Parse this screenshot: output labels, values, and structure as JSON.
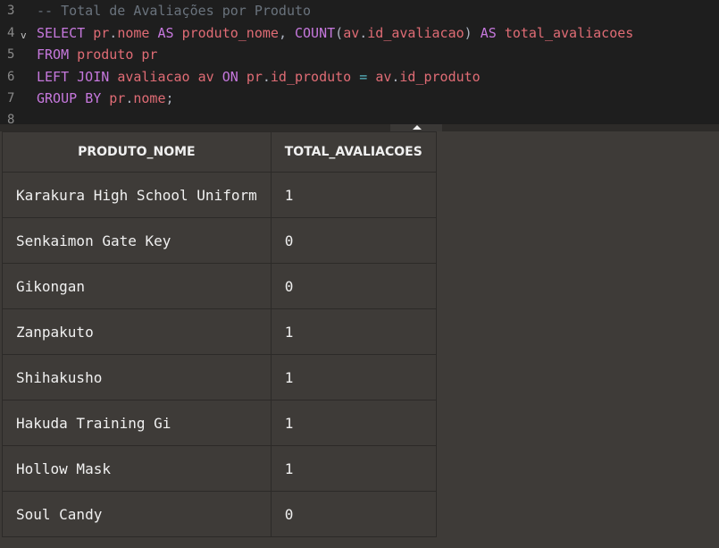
{
  "editor": {
    "lines": [
      {
        "number": "3",
        "tokens": [
          {
            "t": "-- Total de Avaliações por Produto",
            "c": "cm"
          }
        ]
      },
      {
        "number": "4",
        "fold": "v",
        "tokens": [
          {
            "t": "SELECT",
            "c": "kw"
          },
          {
            "t": " ",
            "c": "pu"
          },
          {
            "t": "pr",
            "c": "id"
          },
          {
            "t": ".",
            "c": "pu"
          },
          {
            "t": "nome",
            "c": "id"
          },
          {
            "t": " ",
            "c": "pu"
          },
          {
            "t": "AS",
            "c": "kw"
          },
          {
            "t": " ",
            "c": "pu"
          },
          {
            "t": "produto_nome",
            "c": "id"
          },
          {
            "t": ", ",
            "c": "pu"
          },
          {
            "t": "COUNT",
            "c": "fn"
          },
          {
            "t": "(",
            "c": "pu"
          },
          {
            "t": "av",
            "c": "id"
          },
          {
            "t": ".",
            "c": "pu"
          },
          {
            "t": "id_avaliacao",
            "c": "id"
          },
          {
            "t": ")",
            "c": "pu"
          },
          {
            "t": " ",
            "c": "pu"
          },
          {
            "t": "AS",
            "c": "kw"
          },
          {
            "t": " ",
            "c": "pu"
          },
          {
            "t": "total_avaliacoes",
            "c": "id"
          }
        ]
      },
      {
        "number": "5",
        "tokens": [
          {
            "t": "FROM",
            "c": "kw"
          },
          {
            "t": " ",
            "c": "pu"
          },
          {
            "t": "produto",
            "c": "id"
          },
          {
            "t": " ",
            "c": "pu"
          },
          {
            "t": "pr",
            "c": "id"
          }
        ]
      },
      {
        "number": "6",
        "tokens": [
          {
            "t": "LEFT",
            "c": "kw"
          },
          {
            "t": " ",
            "c": "pu"
          },
          {
            "t": "JOIN",
            "c": "kw"
          },
          {
            "t": " ",
            "c": "pu"
          },
          {
            "t": "avaliacao",
            "c": "id"
          },
          {
            "t": " ",
            "c": "pu"
          },
          {
            "t": "av",
            "c": "id"
          },
          {
            "t": " ",
            "c": "pu"
          },
          {
            "t": "ON",
            "c": "kw"
          },
          {
            "t": " ",
            "c": "pu"
          },
          {
            "t": "pr",
            "c": "id"
          },
          {
            "t": ".",
            "c": "pu"
          },
          {
            "t": "id_produto",
            "c": "id"
          },
          {
            "t": " ",
            "c": "pu"
          },
          {
            "t": "=",
            "c": "op"
          },
          {
            "t": " ",
            "c": "pu"
          },
          {
            "t": "av",
            "c": "id"
          },
          {
            "t": ".",
            "c": "pu"
          },
          {
            "t": "id_produto",
            "c": "id"
          }
        ]
      },
      {
        "number": "7",
        "tokens": [
          {
            "t": "GROUP",
            "c": "kw"
          },
          {
            "t": " ",
            "c": "pu"
          },
          {
            "t": "BY",
            "c": "kw"
          },
          {
            "t": " ",
            "c": "pu"
          },
          {
            "t": "pr",
            "c": "id"
          },
          {
            "t": ".",
            "c": "pu"
          },
          {
            "t": "nome",
            "c": "id"
          },
          {
            "t": ";",
            "c": "pu"
          }
        ]
      },
      {
        "number": "8",
        "tokens": []
      }
    ]
  },
  "results": {
    "columns": [
      "PRODUTO_NOME",
      "TOTAL_AVALIACOES"
    ],
    "rows": [
      [
        "Karakura High School Uniform",
        "1"
      ],
      [
        "Senkaimon Gate Key",
        "0"
      ],
      [
        "Gikongan",
        "0"
      ],
      [
        "Zanpakuto",
        "1"
      ],
      [
        "Shihakusho",
        "1"
      ],
      [
        "Hakuda Training Gi",
        "1"
      ],
      [
        "Hollow Mask",
        "1"
      ],
      [
        "Soul Candy",
        "0"
      ]
    ]
  },
  "colors": {
    "editor_bg": "#1e1e1e",
    "keyword": "#c678dd",
    "identifier": "#e06c75",
    "comment": "#6a737d",
    "results_bg": "#3e3b38"
  }
}
